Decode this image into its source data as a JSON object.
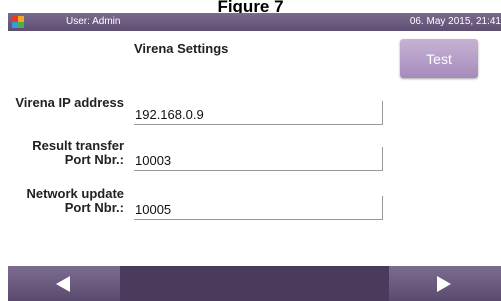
{
  "caption": "Figure 7",
  "topbar": {
    "user": "User: Admin",
    "datetime": "06. May 2015, 21:41"
  },
  "page": {
    "title": "Virena Settings",
    "test_label": "Test"
  },
  "fields": {
    "ip": {
      "label": "Virena IP address",
      "value": "192.168.0.9"
    },
    "result_port": {
      "label_line1": "Result transfer",
      "label_line2": "Port Nbr.:",
      "value": "10003"
    },
    "network_port": {
      "label_line1": "Network update",
      "label_line2": "Port Nbr.:",
      "value": "10005"
    }
  },
  "icons": {
    "logo": "app-logo-icon",
    "back": "arrow-left-icon",
    "forward": "arrow-right-icon"
  }
}
